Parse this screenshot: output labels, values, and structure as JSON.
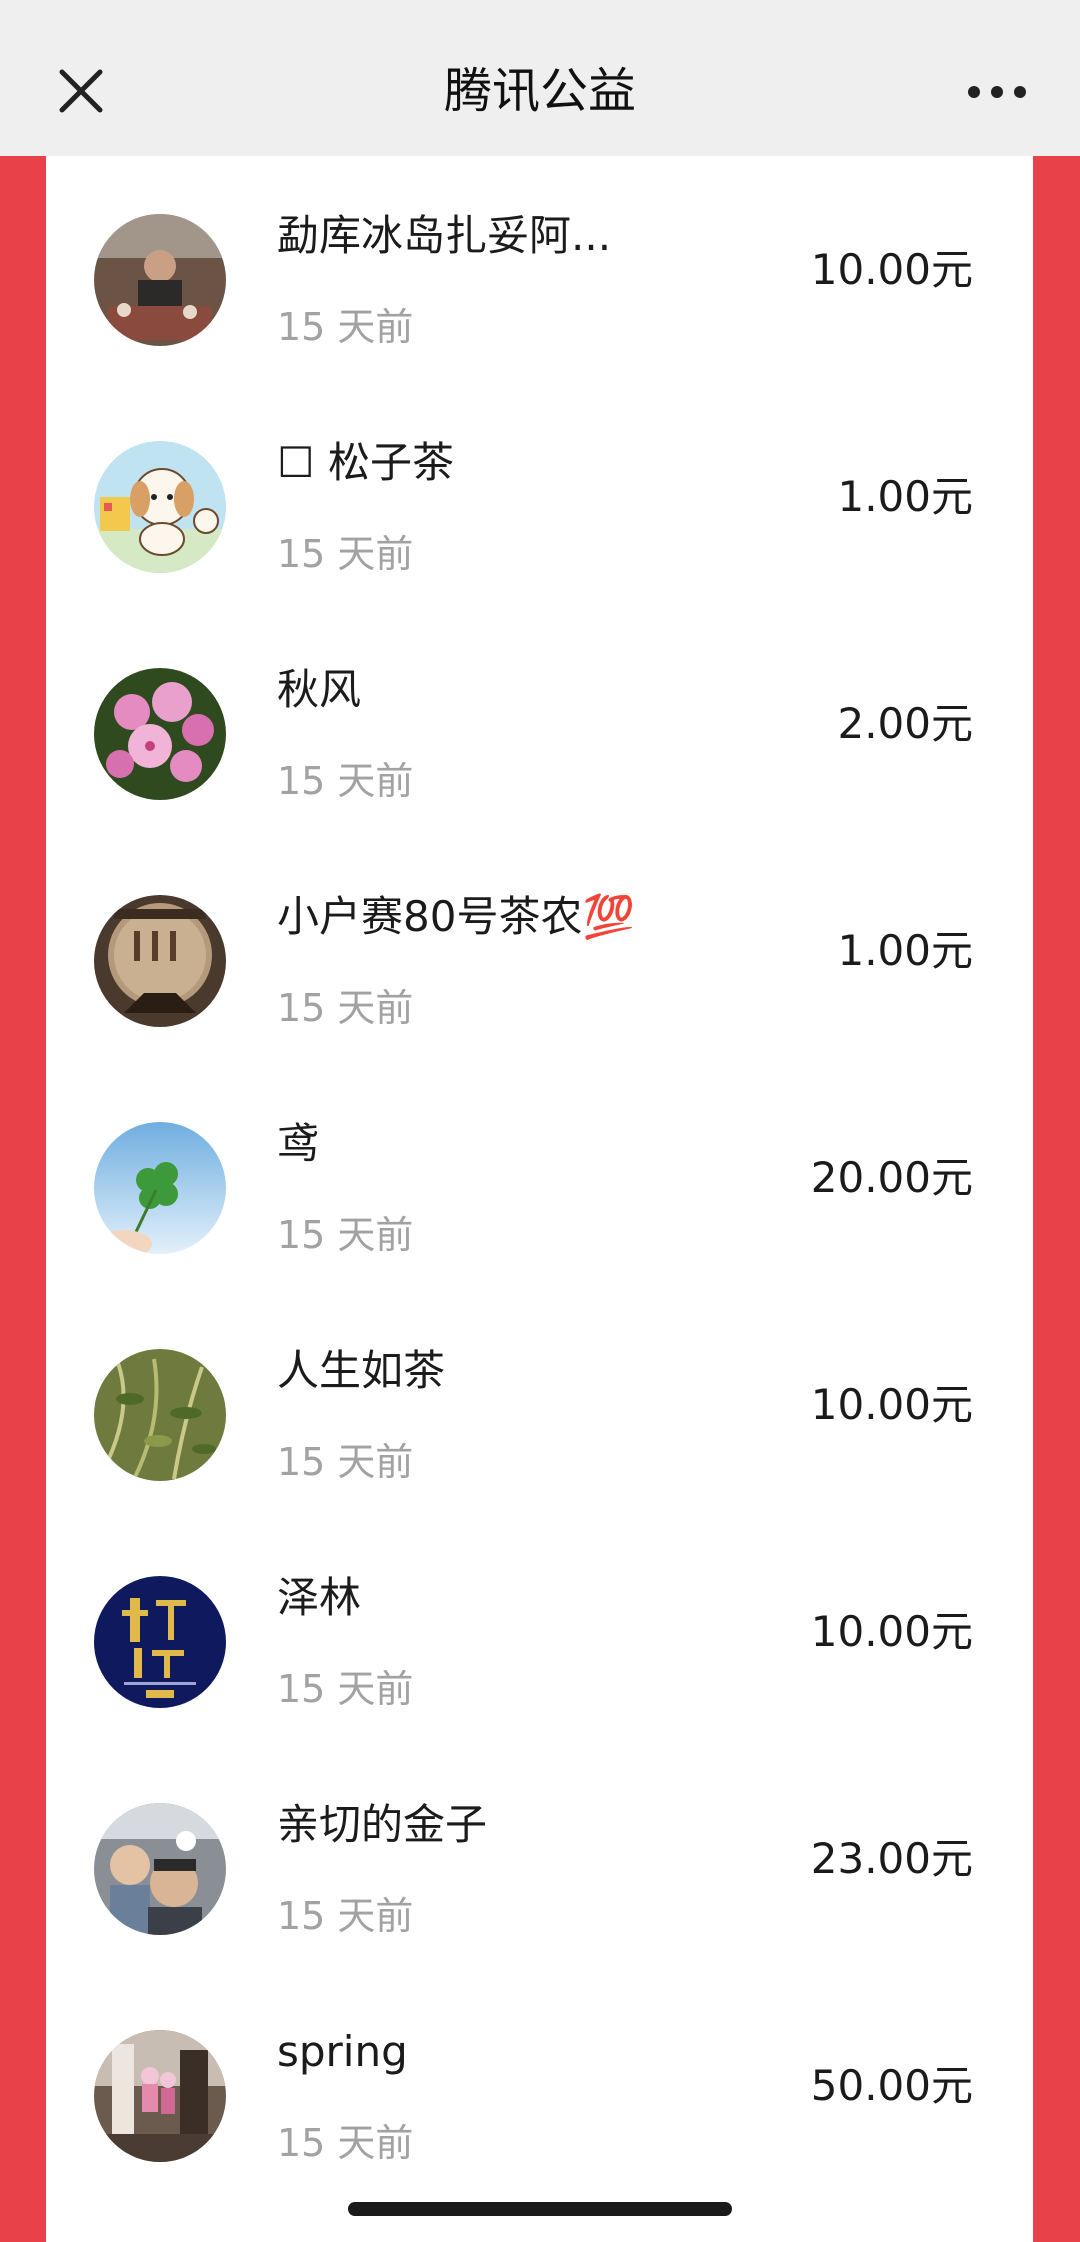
{
  "header": {
    "title": "腾讯公益",
    "close_icon": "close-icon",
    "more_icon": "more-icon"
  },
  "colors": {
    "background_red": "#e8414a",
    "header_bg": "#efefef",
    "text_primary": "#1b1b1b",
    "text_secondary": "#a2a2a2"
  },
  "donations": [
    {
      "name": "勐库冰岛扎妥阿...",
      "time": "15 天前",
      "amount": "10.00元"
    },
    {
      "name": "☐ 松子茶",
      "time": "15 天前",
      "amount": "1.00元"
    },
    {
      "name": "秋风",
      "time": "15 天前",
      "amount": "2.00元"
    },
    {
      "name": "小户赛80号茶农💯",
      "time": "15 天前",
      "amount": "1.00元"
    },
    {
      "name": "鸢",
      "time": "15 天前",
      "amount": "20.00元"
    },
    {
      "name": "人生如茶",
      "time": "15 天前",
      "amount": "10.00元"
    },
    {
      "name": "泽林",
      "time": "15 天前",
      "amount": "10.00元"
    },
    {
      "name": "亲切的金子",
      "time": "15 天前",
      "amount": "23.00元"
    },
    {
      "name": "spring",
      "time": "15 天前",
      "amount": "50.00元"
    }
  ]
}
